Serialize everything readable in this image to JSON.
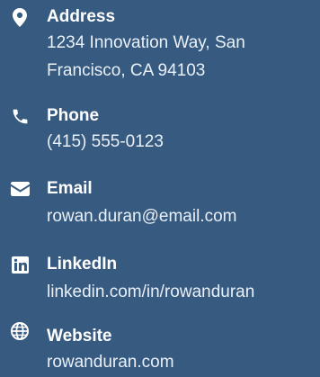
{
  "contacts": {
    "address": {
      "icon": "map-marker-icon",
      "label": "Address",
      "value_line1": "1234 Innovation Way, San",
      "value_line2": "Francisco, CA 94103"
    },
    "phone": {
      "icon": "phone-icon",
      "label": "Phone",
      "value": "(415) 555-0123"
    },
    "email": {
      "icon": "envelope-icon",
      "label": "Email",
      "value": "rowan.duran@email.com"
    },
    "linkedin": {
      "icon": "linkedin-icon",
      "label": "LinkedIn",
      "value": "linkedin.com/in/rowanduran"
    },
    "website": {
      "icon": "globe-icon",
      "label": "Website",
      "value": "rowanduran.com"
    }
  },
  "colors": {
    "background": "#375a80",
    "text": "#ffffff"
  }
}
